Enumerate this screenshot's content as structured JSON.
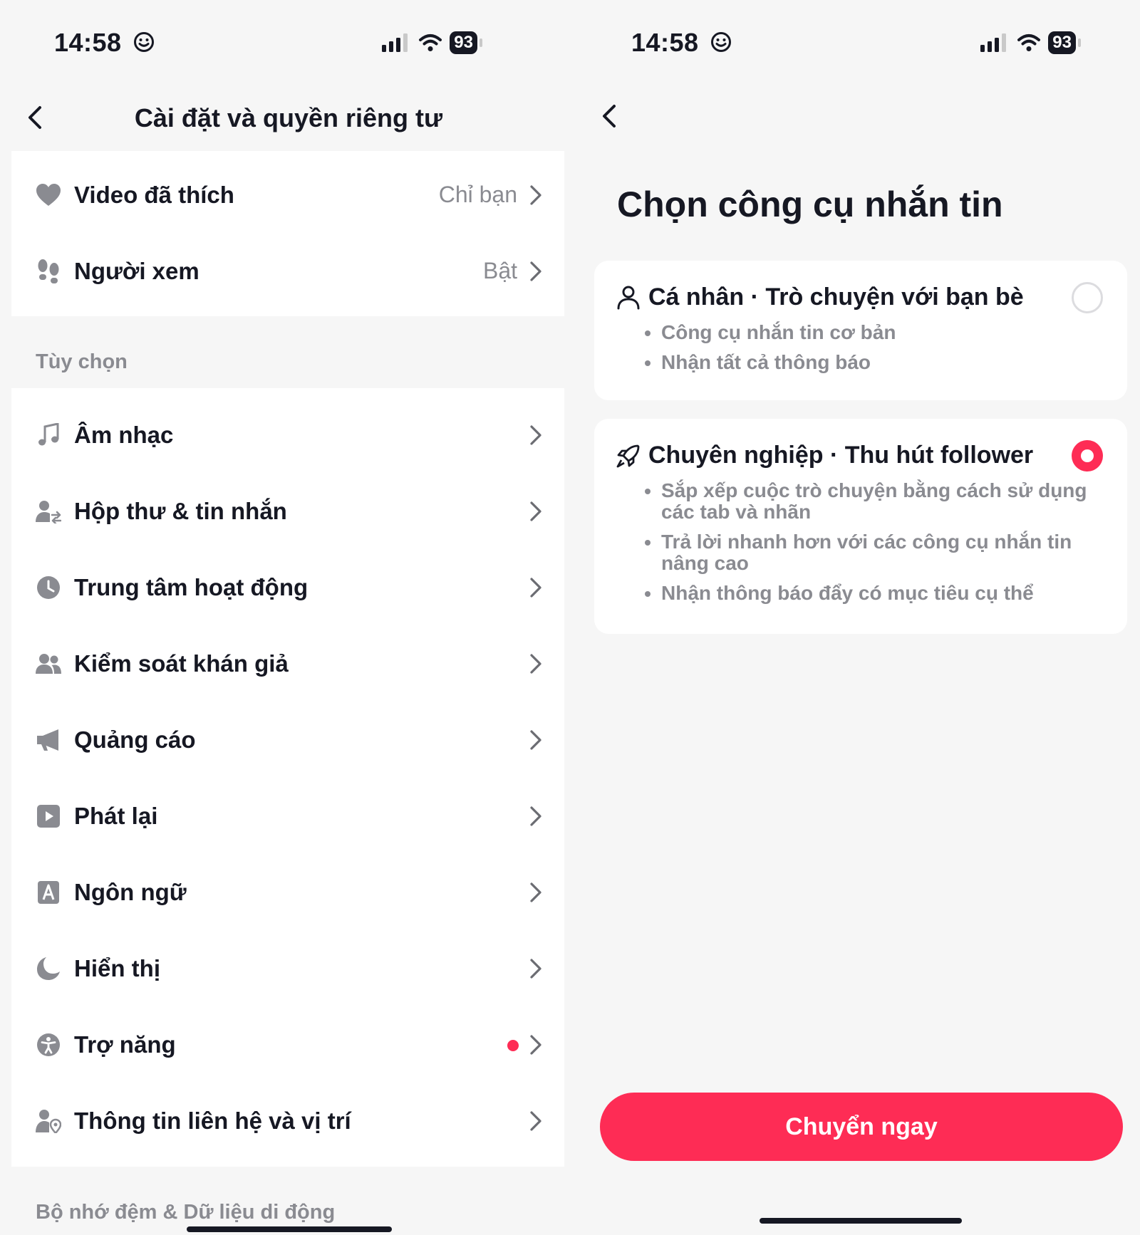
{
  "colors": {
    "accent": "#fe2c55",
    "text": "#161823",
    "muted": "#8a8b91",
    "background": "#f6f6f6",
    "card": "#ffffff"
  },
  "status_bar": {
    "time": "14:58",
    "battery": "93"
  },
  "settings": {
    "title": "Cài đặt và quyền riêng tư",
    "privacy_rows": [
      {
        "icon": "heart-icon",
        "label": "Video đã thích",
        "value": "Chỉ bạn"
      },
      {
        "icon": "footprints-icon",
        "label": "Người xem",
        "value": "Bật"
      }
    ],
    "section_preferences": "Tùy chọn",
    "preference_rows": [
      {
        "icon": "music-note-icon",
        "label": "Âm nhạc"
      },
      {
        "icon": "inbox-icon",
        "label": "Hộp thư & tin nhắn"
      },
      {
        "icon": "clock-icon",
        "label": "Trung tâm hoạt động"
      },
      {
        "icon": "audience-icon",
        "label": "Kiểm soát khán giả"
      },
      {
        "icon": "megaphone-icon",
        "label": "Quảng cáo"
      },
      {
        "icon": "play-icon",
        "label": "Phát lại"
      },
      {
        "icon": "language-icon",
        "label": "Ngôn ngữ"
      },
      {
        "icon": "moon-icon",
        "label": "Hiển thị"
      },
      {
        "icon": "accessibility-icon",
        "label": "Trợ năng",
        "badge": true
      },
      {
        "icon": "contact-location-icon",
        "label": "Thông tin liên hệ và vị trí"
      }
    ],
    "section_cache": "Bộ nhớ đệm & Dữ liệu di động"
  },
  "messaging": {
    "title": "Chọn công cụ nhắn tin",
    "options": [
      {
        "icon": "person-icon",
        "title": "Cá nhân · Trò chuyện với bạn bè",
        "selected": false,
        "bullets": [
          "Công cụ nhắn tin cơ bản",
          "Nhận tất cả thông báo"
        ]
      },
      {
        "icon": "rocket-icon",
        "title": "Chuyên nghiệp · Thu hút follower",
        "selected": true,
        "bullets": [
          "Sắp xếp cuộc trò chuyện bằng cách sử dụng các tab và nhãn",
          "Trả lời nhanh hơn với các công cụ nhắn tin nâng cao",
          "Nhận thông báo đẩy có mục tiêu cụ thể"
        ]
      }
    ],
    "cta_label": "Chuyển ngay"
  }
}
